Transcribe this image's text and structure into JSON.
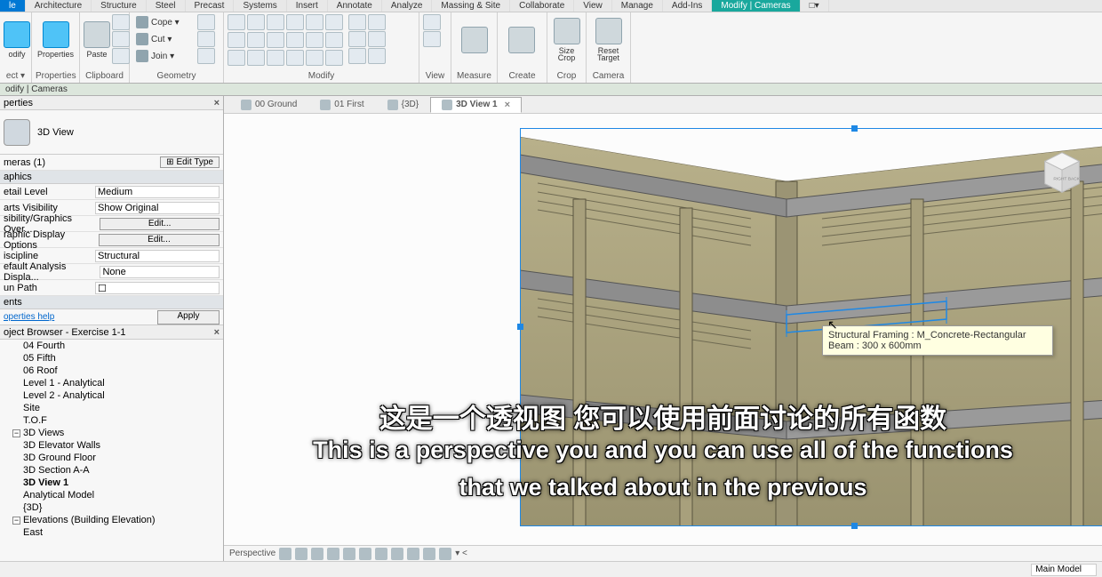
{
  "tabs": {
    "file": "le",
    "architecture": "Architecture",
    "structure": "Structure",
    "steel": "Steel",
    "precast": "Precast",
    "systems": "Systems",
    "insert": "Insert",
    "annotate": "Annotate",
    "analyze": "Analyze",
    "massing": "Massing & Site",
    "collaborate": "Collaborate",
    "view": "View",
    "manage": "Manage",
    "addins": "Add-Ins",
    "modify": "Modify | Cameras",
    "extra": "□▾"
  },
  "ribbon": {
    "select": {
      "modify": "odify",
      "panel": "ect ▾"
    },
    "properties": {
      "btn": "Properties",
      "panel": "Properties"
    },
    "clipboard": {
      "paste": "Paste",
      "cope": "Cope ▾",
      "cut": "Cut ▾",
      "join": "Join ▾",
      "panel": "Clipboard"
    },
    "geometry": {
      "panel": "Geometry"
    },
    "modify": {
      "panel": "Modify"
    },
    "view": {
      "panel": "View"
    },
    "measure": {
      "panel": "Measure"
    },
    "create": {
      "panel": "Create"
    },
    "crop": {
      "size": "Size",
      "crop": "Crop",
      "panel": "Crop"
    },
    "camera": {
      "reset": "Reset",
      "target": "Target",
      "panel": "Camera"
    }
  },
  "contextbar": "odify | Cameras",
  "properties": {
    "title": "perties",
    "family": "3D View",
    "instance": "meras (1)",
    "edit_type": "Edit Type",
    "cat_graphics": "aphics",
    "detail_level": {
      "k": "etail Level",
      "v": "Medium"
    },
    "parts": {
      "k": "arts Visibility",
      "v": "Show Original"
    },
    "vg": {
      "k": "sibility/Graphics Over...",
      "v": "Edit..."
    },
    "gdo": {
      "k": "raphic Display Options",
      "v": "Edit..."
    },
    "discipline": {
      "k": "iscipline",
      "v": "Structural"
    },
    "analysis": {
      "k": "efault Analysis Displa...",
      "v": "None"
    },
    "sunpath": {
      "k": "un Path"
    },
    "cat_extents": "ents",
    "help": "operties help",
    "apply": "Apply"
  },
  "browser": {
    "title": "oject Browser - Exercise 1-1",
    "items": {
      "fourth": "04 Fourth",
      "fifth": "05 Fifth",
      "roof": "06 Roof",
      "l1a": "Level 1 - Analytical",
      "l2a": "Level 2 - Analytical",
      "site": "Site",
      "tof": "T.O.F",
      "views3d": "3D Views",
      "elev_walls": "3D Elevator Walls",
      "ground": "3D Ground Floor",
      "section": "3D Section A-A",
      "view1": "3D View 1",
      "anmodel": "Analytical Model",
      "three_d": "{3D}",
      "elevations": "Elevations (Building Elevation)",
      "east": "East"
    }
  },
  "viewtabs": {
    "ground": "00 Ground",
    "first": "01 First",
    "three_d": "{3D}",
    "active": "3D View 1"
  },
  "tooltip": "Structural Framing : M_Concrete-Rectangular Beam : 300 x 600mm",
  "viewcube": {
    "right": "RIGHT",
    "back": "BACK"
  },
  "subtitles": {
    "cn": "这是一个透视图 您可以使用前面讨论的所有函数",
    "en1": "This is a perspective you and you can use all of the functions",
    "en2": "that we talked about in the previous"
  },
  "viewcontrol": {
    "mode": "Perspective"
  },
  "status": {
    "main_model": "Main Model"
  }
}
